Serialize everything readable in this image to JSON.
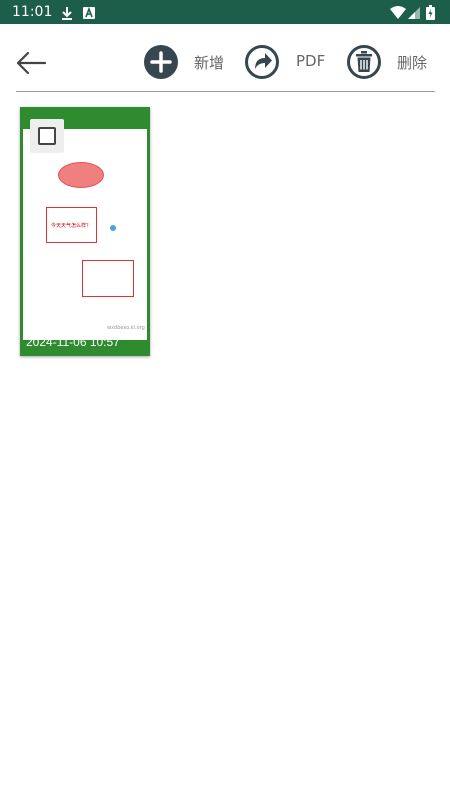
{
  "status_bar": {
    "time": "11:01",
    "icons": [
      "download-icon",
      "text-a-icon",
      "wifi-icon",
      "signal-icon",
      "battery-icon"
    ]
  },
  "toolbar": {
    "back_icon": "arrow-left-icon",
    "buttons": [
      {
        "icon": "plus-circle-icon",
        "label": "新增"
      },
      {
        "icon": "share-arrow-icon",
        "label": "PDF"
      },
      {
        "icon": "trash-icon",
        "label": "删除"
      }
    ]
  },
  "documents": [
    {
      "date": "2024-11-06 10:57",
      "checked": false,
      "thumbnail_text": "今天天气怎么样？",
      "watermark": "wxdbexo.kl.org"
    }
  ],
  "colors": {
    "status_bar": "#1d5e4b",
    "card": "#2e8b2e",
    "icon_dark": "#37474f",
    "label": "#666666"
  }
}
